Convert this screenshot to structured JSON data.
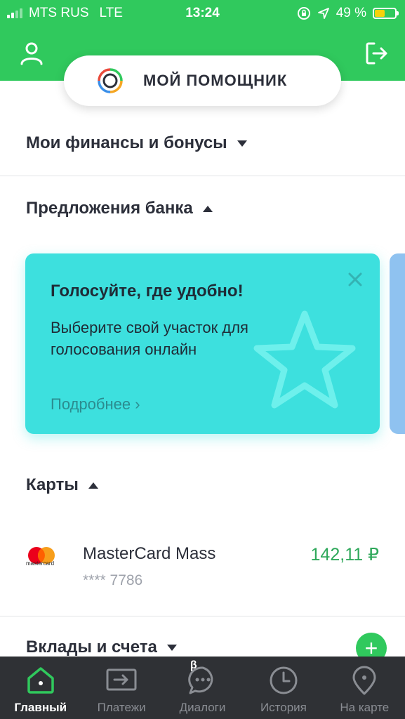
{
  "status_bar": {
    "carrier": "MTS RUS",
    "network": "LTE",
    "time": "13:24",
    "battery": "49 %",
    "battery_level": 0.49,
    "icons": [
      "signal-icon",
      "lock-rotation-icon",
      "location-arrow-icon",
      "battery-icon"
    ]
  },
  "header": {
    "profile_icon": "user-icon",
    "logout_icon": "logout-icon",
    "assistant_label": "МОЙ ПОМОЩНИК"
  },
  "sections": {
    "finances": {
      "title": "Мои финансы и бонусы",
      "expanded": false
    },
    "offers": {
      "title": "Предложения банка",
      "expanded": true
    },
    "cards": {
      "title": "Карты",
      "expanded": true
    },
    "deposits": {
      "title": "Вклады и счета",
      "expanded": false
    }
  },
  "promo": {
    "title": "Голосуйте, где удобно!",
    "text": "Выберите свой участок для голосования онлайн",
    "link": "Подробнее ›",
    "close_icon": "close-icon",
    "decor_icon": "star-icon"
  },
  "card": {
    "brand": "mastercard",
    "name": "MasterCard Mass",
    "number": "**** 7786",
    "balance": "142,11 ₽"
  },
  "add_button": "+",
  "tabs": [
    {
      "label": "Главный",
      "icon": "home-icon",
      "active": true
    },
    {
      "label": "Платежи",
      "icon": "transfer-icon",
      "active": false
    },
    {
      "label": "Диалоги",
      "icon": "chat-icon",
      "active": false,
      "badge": "β"
    },
    {
      "label": "История",
      "icon": "clock-icon",
      "active": false
    },
    {
      "label": "На карте",
      "icon": "map-pin-icon",
      "active": false
    }
  ],
  "colors": {
    "brand_green": "#30c95d",
    "promo_cyan": "#3de0de",
    "balance_green": "#2ea85a",
    "tabbar_bg": "#2f3135"
  }
}
